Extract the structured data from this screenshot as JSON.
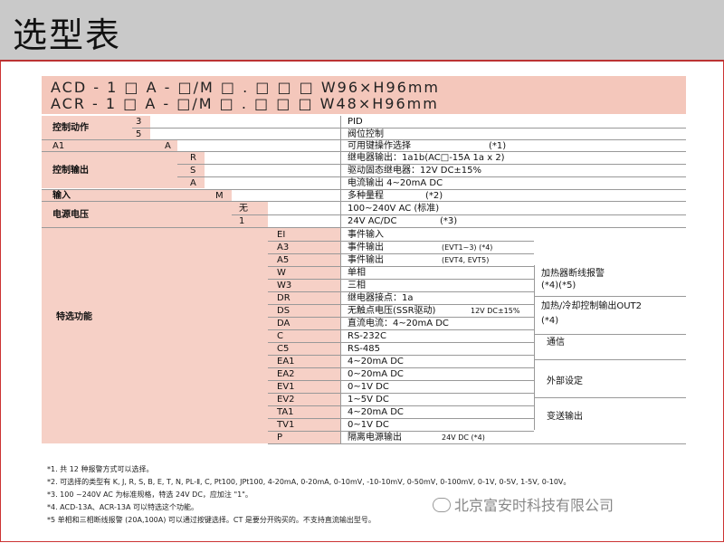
{
  "title": "选型表",
  "header": {
    "row1": "ACD - 1 □ A - □/M □ . □ □ □   W96×H96mm",
    "row2": "ACR - 1 □ A - □/M □ . □ □ □   W48×H96mm"
  },
  "table": {
    "control_action": {
      "label": "控制动作",
      "codes": [
        "3",
        "5"
      ],
      "descs": [
        "PID",
        "阀位控制"
      ]
    },
    "a1": {
      "label": "A1",
      "code": "A",
      "desc": "可用键操作选择",
      "note": "(*1)"
    },
    "control_output": {
      "label": "控制输出",
      "codes": [
        "R",
        "S",
        "A"
      ],
      "descs": [
        "继电器输出：1a1b(AC□-15A  1a x 2)",
        "驱动固态继电器：12V DC±15%",
        "电流输出 4~20mA DC"
      ]
    },
    "input": {
      "label": "输入",
      "code": "M",
      "desc": "多种量程",
      "note": "(*2)"
    },
    "power": {
      "label": "电源电压",
      "codes": [
        "无",
        "1"
      ],
      "descs": [
        "100~240V AC (标准)",
        "24V AC/DC"
      ],
      "note": "(*3)"
    },
    "special": {
      "label": "特选功能",
      "rows": [
        {
          "code": "EI",
          "desc": "事件输入",
          "extra": ""
        },
        {
          "code": "A3",
          "desc": "事件输出",
          "extra": "(EVT1~3)        (*4)"
        },
        {
          "code": "A5",
          "desc": "事件输出",
          "extra": "(EVT4, EVT5)"
        },
        {
          "code": "W",
          "desc": "单相",
          "extra": ""
        },
        {
          "code": "W3",
          "desc": "三相",
          "extra": ""
        },
        {
          "code": "DR",
          "desc": "继电器接点：1a",
          "extra": ""
        },
        {
          "code": "DS",
          "desc": "无触点电压(SSR驱动)",
          "extra": "12V DC±15%"
        },
        {
          "code": "DA",
          "desc": "直流电流：4~20mA DC",
          "extra": ""
        },
        {
          "code": "C",
          "desc": "RS-232C",
          "extra": ""
        },
        {
          "code": "C5",
          "desc": "RS-485",
          "extra": ""
        },
        {
          "code": "EA1",
          "desc": "4~20mA DC",
          "extra": ""
        },
        {
          "code": "EA2",
          "desc": "0~20mA DC",
          "extra": ""
        },
        {
          "code": "EV1",
          "desc": "0~1V DC",
          "extra": ""
        },
        {
          "code": "EV2",
          "desc": "1~5V DC",
          "extra": ""
        },
        {
          "code": "TA1",
          "desc": "4~20mA DC",
          "extra": ""
        },
        {
          "code": "TV1",
          "desc": "0~1V DC",
          "extra": ""
        },
        {
          "code": "P",
          "desc": "隔离电源输出",
          "extra": "24V DC          (*4)"
        }
      ],
      "groups": [
        {
          "label": "加热器断线报警",
          "note": "(*4)(*5)"
        },
        {
          "label": "加热/冷却控制输出OUT2",
          "note": "(*4)"
        },
        {
          "label": "通信",
          "note": ""
        },
        {
          "label": "外部设定",
          "note": ""
        },
        {
          "label": "变送输出",
          "note": ""
        }
      ]
    }
  },
  "notes": [
    "*1.   共 12 种报警方式可以选择。",
    "*2.   可选择的类型有 K, J, R, S, B, E, T, N, PL-Ⅱ, C, Pt100, JPt100, 4-20mA, 0-20mA, 0-10mV, -10-10mV, 0-50mV, 0-100mV, 0-1V, 0-5V, 1-5V, 0-10V。",
    "*3.   100  ~240V AC 为标准规格，特选 24V DC，应加注 \"1\"。",
    "*4.   ACD-13A、ACR-13A 可以特选这个功能。",
    "*5    单相和三相断线报警 (20A,100A) 可以通过按键选择。CT 是要分开购买的。不支持直流输出型号。"
  ],
  "watermark": "北京富安时科技有限公司"
}
